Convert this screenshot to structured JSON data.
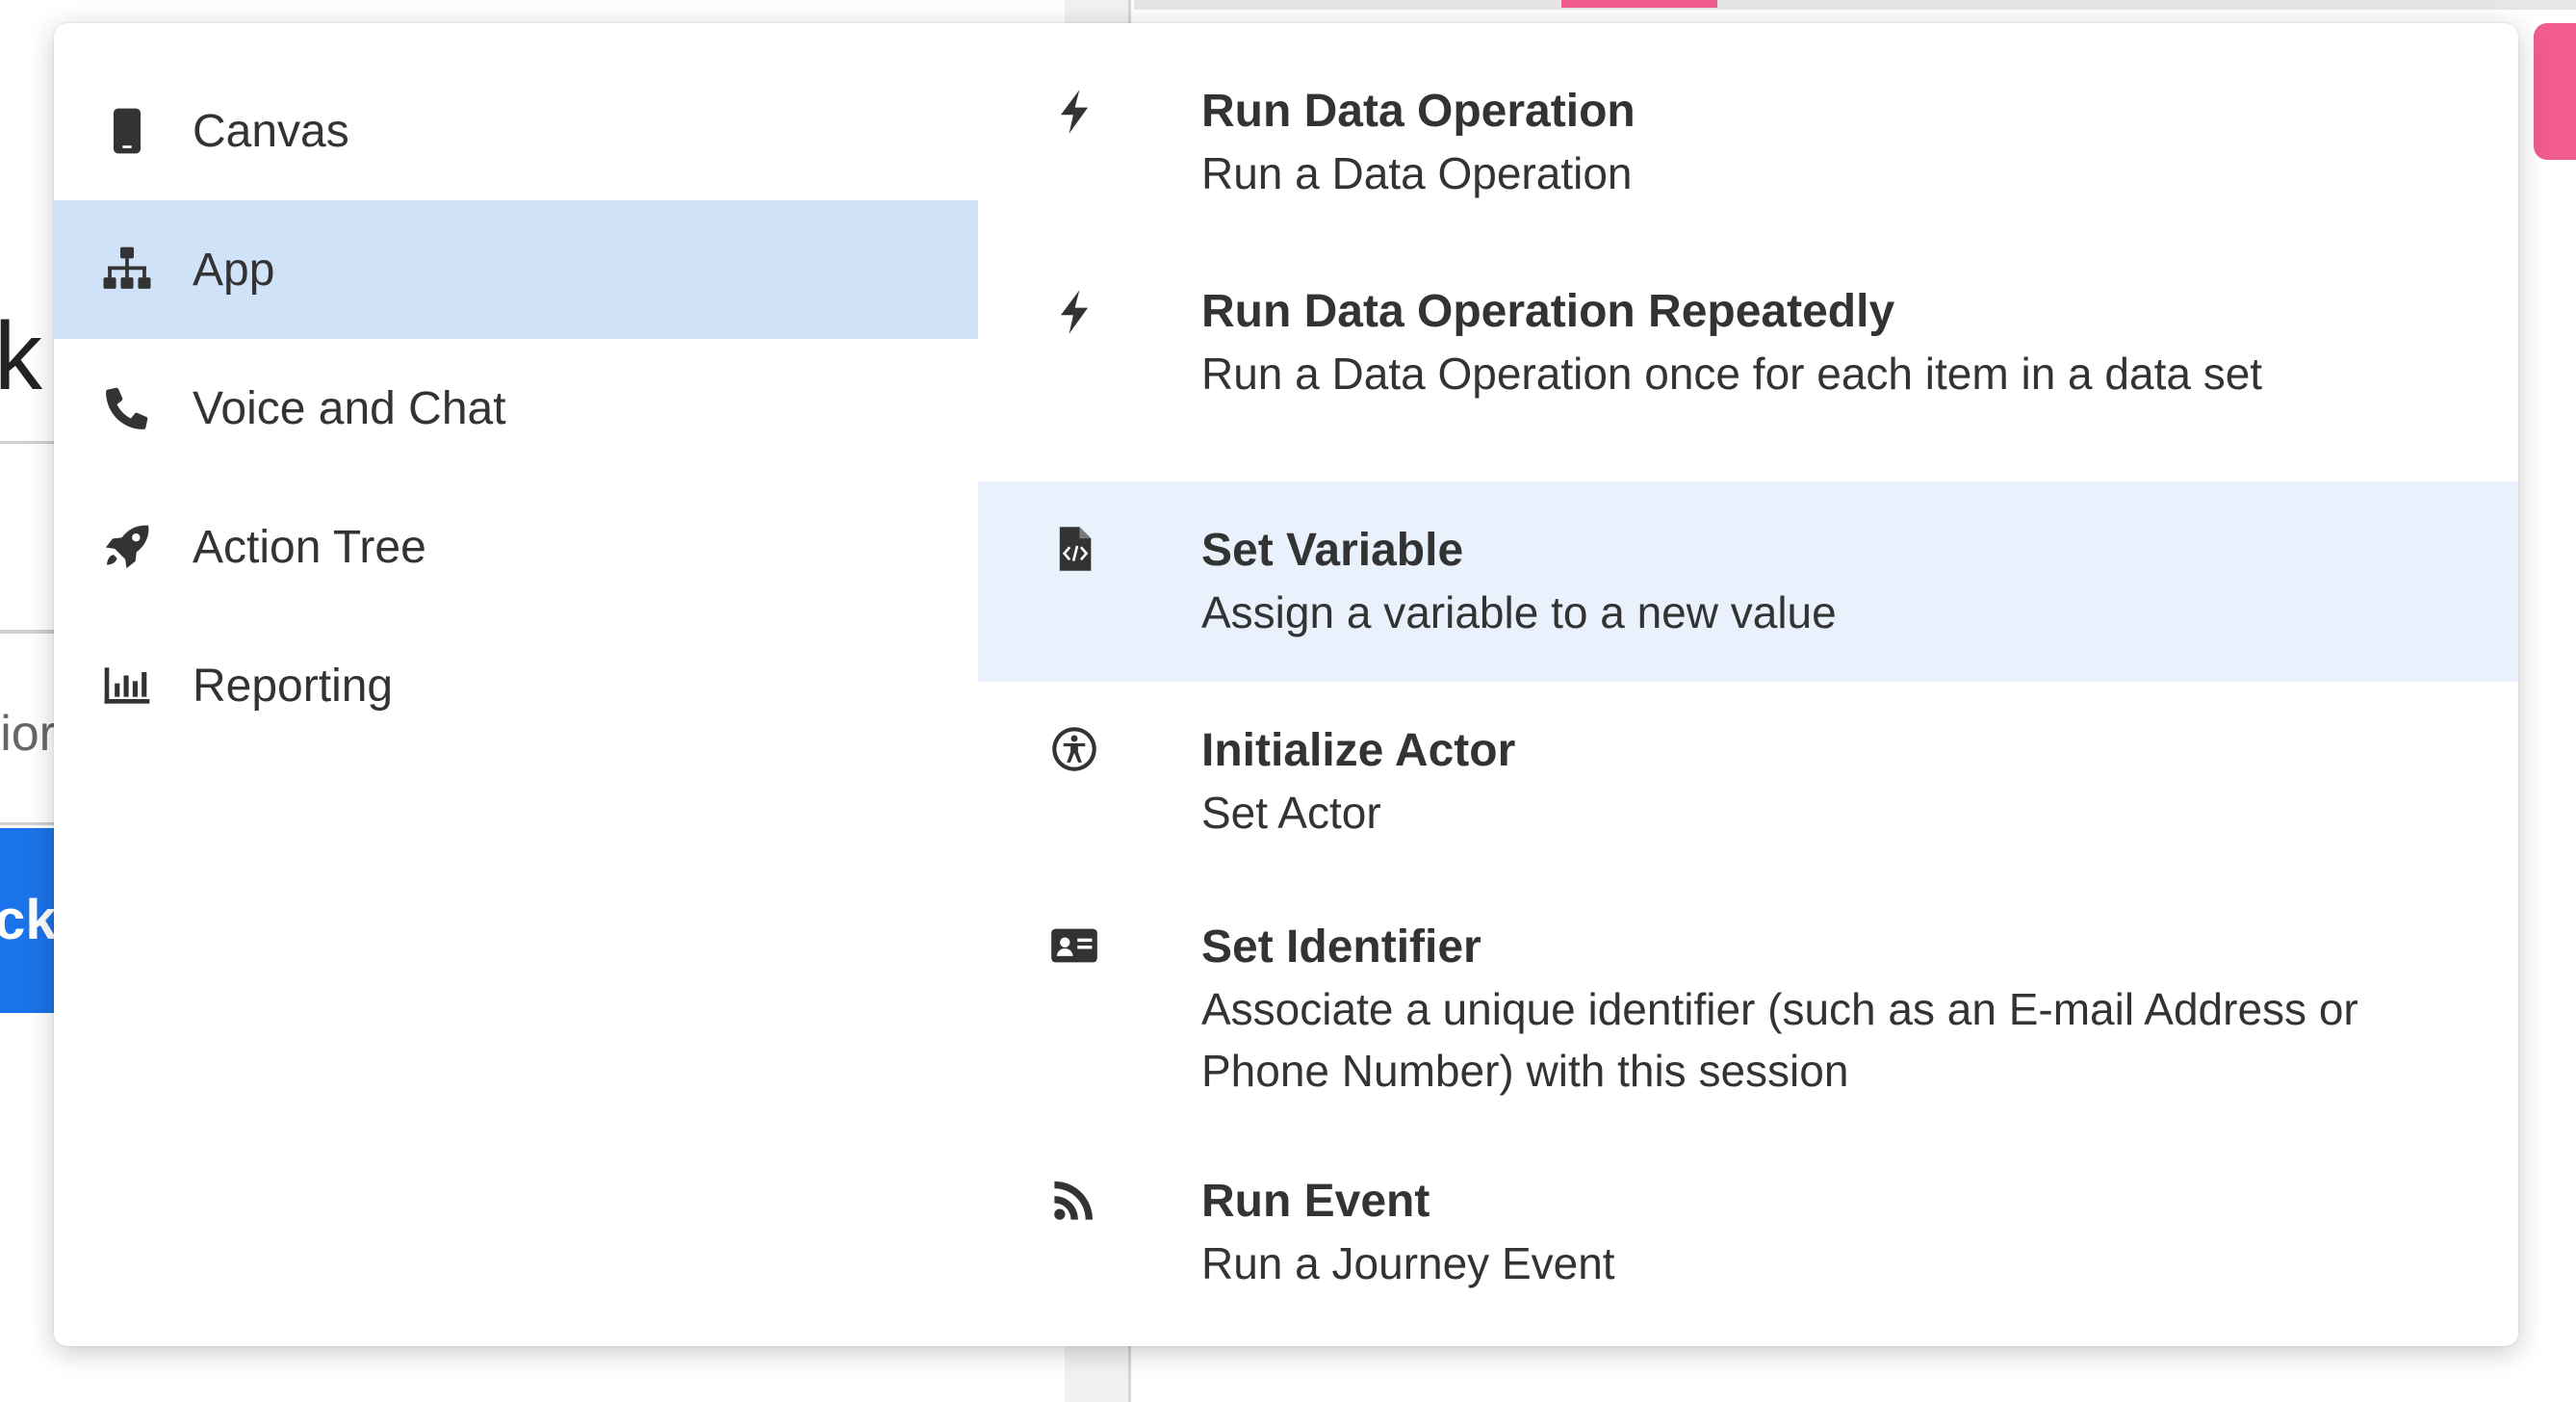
{
  "background": {
    "heading_fragment": "k",
    "subtext_fragment": "tior",
    "button_fragment": "ick",
    "colors": {
      "pink": "#ef5c8d",
      "blue": "#1a73e8"
    }
  },
  "categories": [
    {
      "label": "Canvas",
      "icon": "mobile-phone-icon",
      "selected": false
    },
    {
      "label": "App",
      "icon": "sitemap-icon",
      "selected": true
    },
    {
      "label": "Voice and Chat",
      "icon": "phone-icon",
      "selected": false
    },
    {
      "label": "Action Tree",
      "icon": "rocket-icon",
      "selected": false
    },
    {
      "label": "Reporting",
      "icon": "bar-chart-icon",
      "selected": false
    }
  ],
  "actions": [
    {
      "title": "Run Data Operation",
      "description": "Run a Data Operation",
      "icon": "bolt-icon",
      "highlighted": false
    },
    {
      "title": "Run Data Operation Repeatedly",
      "description": "Run a Data Operation once for each item in a data set",
      "icon": "bolt-icon",
      "highlighted": false
    },
    {
      "title": "Set Variable",
      "description": "Assign a variable to a new value",
      "icon": "file-code-icon",
      "highlighted": true
    },
    {
      "title": "Initialize Actor",
      "description": "Set Actor",
      "icon": "accessibility-icon",
      "highlighted": false
    },
    {
      "title": "Set Identifier",
      "description": "Associate a unique identifier (such as an E-mail Address or Phone Number) with this session",
      "icon": "id-card-icon",
      "highlighted": false
    },
    {
      "title": "Run Event",
      "description": "Run a Journey Event",
      "icon": "rss-icon",
      "highlighted": false
    }
  ],
  "colors": {
    "selected_category_bg": "#cfe2f8",
    "highlighted_action_bg": "#e8f1fc",
    "text": "#333333"
  }
}
